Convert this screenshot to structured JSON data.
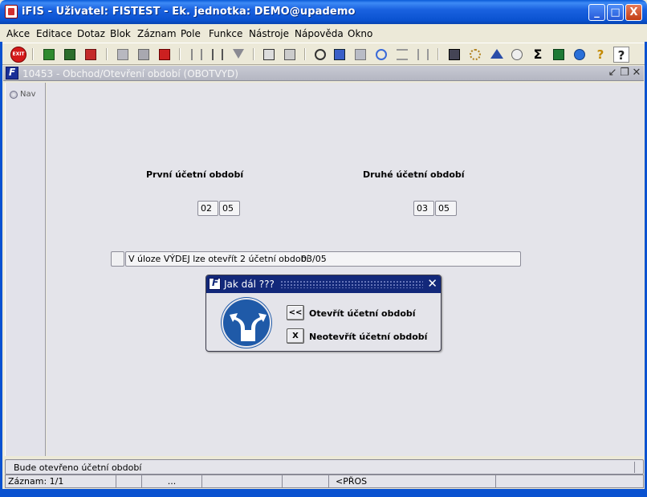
{
  "window": {
    "title": "iFIS - Uživatel: FISTEST - Ek. jednotka: DEMO@upademo",
    "controls": [
      "_",
      "□",
      "X"
    ]
  },
  "menu": [
    "Akce",
    "Editace",
    "Dotaz",
    "Blok",
    "Záznam",
    "Pole",
    "Funkce",
    "Nástroje",
    "Nápověda",
    "Okno"
  ],
  "toolbar": {
    "exit_label": "EXIT",
    "buttons": [
      "exit-icon",
      "insert-record-icon",
      "save-icon",
      "delete-record-icon",
      "query-icon",
      "execute-query-icon",
      "cancel-query-icon",
      "sort-asc-icon",
      "sort-desc-icon",
      "filter-icon",
      "print-icon",
      "print-preview-icon",
      "cut-icon",
      "copy-icon",
      "paste-icon",
      "find-icon",
      "list-icon",
      "columns-icon",
      "calculator-icon",
      "wheel-icon",
      "chart-icon",
      "clock-icon",
      "sum-icon",
      "excel-icon",
      "ie-icon",
      "help-icon",
      "context-help-icon"
    ],
    "sum_glyph": "Σ",
    "help_glyph": "?"
  },
  "doc": {
    "title": "10453 - Obchod/Otevření období (OBOTVYD)",
    "nav_label": "Nav"
  },
  "form": {
    "first_period_label": "První účetní období",
    "first_period_month": "02",
    "first_period_year": "05",
    "second_period_label": "Druhé účetní období",
    "second_period_month": "03",
    "second_period_year": "05",
    "message": "V úloze VÝDEJ lze otevřít 2 účetní období",
    "message_period": "03/05"
  },
  "dialog": {
    "title": "Jak dál ???",
    "option1_button": "<<",
    "option1_label": "Otevřít účetní období",
    "option2_button": "X",
    "option2_label": "Neotevřít účetní období"
  },
  "status": {
    "message": "Bude otevřeno účetní období",
    "record": "Záznam: 1/1",
    "cell3": "...",
    "mode": "<PŘOS"
  }
}
